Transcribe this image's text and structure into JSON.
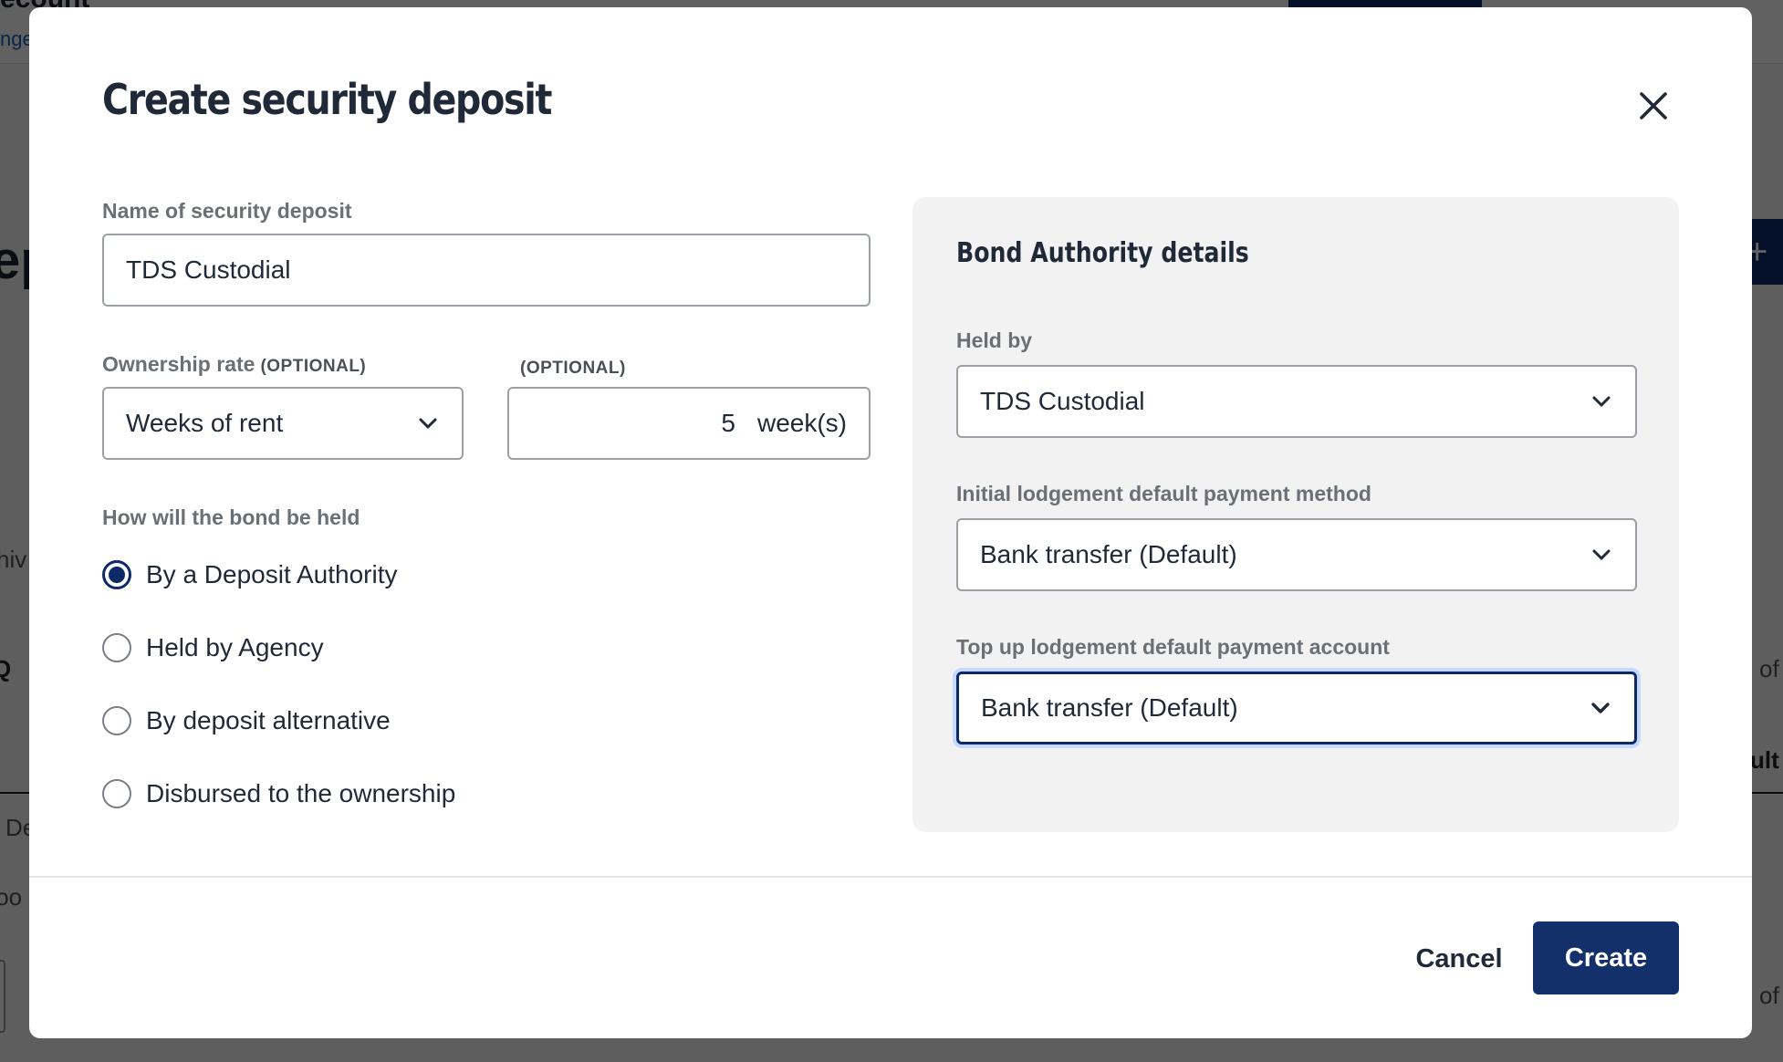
{
  "background": {
    "title_fragment": "ecount",
    "link_fragment": "nge",
    "heading_fragment": "ep",
    "plus_label": "+",
    "text_fragments": [
      "hiv",
      "Q",
      "of",
      "ult",
      "De",
      "too",
      "of"
    ]
  },
  "modal": {
    "title": "Create security deposit",
    "close_icon": "close-icon"
  },
  "form": {
    "name_label": "Name of security deposit",
    "name_value": "TDS Custodial",
    "ownership_label": "Ownership rate",
    "optional_tag": "(OPTIONAL)",
    "ownership_value": "Weeks of rent",
    "weeks_value": "5",
    "weeks_unit": "week(s)",
    "held_label": "How will the bond be held",
    "options": [
      {
        "label": "By a Deposit Authority",
        "checked": true
      },
      {
        "label": "Held by Agency",
        "checked": false
      },
      {
        "label": "By deposit alternative",
        "checked": false
      },
      {
        "label": "Disbursed to the ownership",
        "checked": false
      }
    ]
  },
  "panel": {
    "title": "Bond Authority details",
    "held_by_label": "Held by",
    "held_by_value": "TDS Custodial",
    "initial_label": "Initial lodgement default payment method",
    "initial_value": "Bank transfer (Default)",
    "topup_label": "Top up lodgement default payment account",
    "topup_value": "Bank transfer (Default)"
  },
  "footer": {
    "cancel_label": "Cancel",
    "create_label": "Create"
  },
  "colors": {
    "primary": "#13306b",
    "focus_ring": "#c6d8ff",
    "panel_bg": "#f2f2f2"
  }
}
